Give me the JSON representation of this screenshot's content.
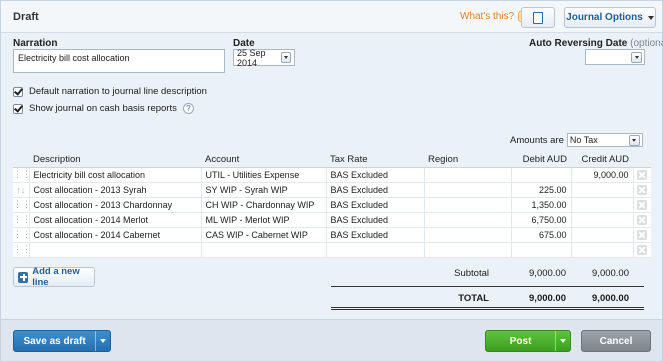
{
  "header": {
    "title": "Draft",
    "whats_this": "What's this?",
    "journal_options": "Journal Options"
  },
  "form": {
    "narration_label": "Narration",
    "narration_value": "Electricity bill cost allocation",
    "date_label": "Date",
    "date_value": "25 Sep 2014",
    "auto_reversing_label": "Auto Reversing Date",
    "auto_reversing_optional": "(optional)",
    "auto_reversing_value": "",
    "default_narration_label": "Default narration to journal line description",
    "default_narration_checked": true,
    "cash_basis_label": "Show journal on cash basis reports",
    "cash_basis_checked": true,
    "help_glyph": "?"
  },
  "amounts": {
    "label": "Amounts are",
    "value": "No Tax"
  },
  "table": {
    "columns": {
      "description": "Description",
      "account": "Account",
      "tax_rate": "Tax Rate",
      "region": "Region",
      "debit": "Debit AUD",
      "credit": "Credit AUD"
    },
    "rows": [
      {
        "handle": "⋮⋮",
        "description": "Electricity bill cost allocation",
        "account": "UTIL - Utilities Expense",
        "tax_rate": "BAS Excluded",
        "region": "",
        "debit": "",
        "credit": "9,000.00"
      },
      {
        "handle": "↑↓",
        "description": "Cost allocation - 2013 Syrah",
        "account": "SY WIP - Syrah WIP",
        "tax_rate": "BAS Excluded",
        "region": "",
        "debit": "225.00",
        "credit": ""
      },
      {
        "handle": "⋮⋮",
        "description": "Cost allocation - 2013 Chardonnay",
        "account": "CH WIP - Chardonnay WIP",
        "tax_rate": "BAS Excluded",
        "region": "",
        "debit": "1,350.00",
        "credit": ""
      },
      {
        "handle": "⋮⋮",
        "description": "Cost allocation - 2014 Merlot",
        "account": "ML WIP - Merlot WIP",
        "tax_rate": "BAS Excluded",
        "region": "",
        "debit": "6,750.00",
        "credit": ""
      },
      {
        "handle": "⋮⋮",
        "description": "Cost allocation - 2014 Cabernet",
        "account": "CAS WIP - Cabernet WIP",
        "tax_rate": "BAS Excluded",
        "region": "",
        "debit": "675.00",
        "credit": ""
      },
      {
        "handle": "⋮⋮",
        "description": "",
        "account": "",
        "tax_rate": "",
        "region": "",
        "debit": "",
        "credit": ""
      }
    ]
  },
  "add_line": "Add a new line",
  "totals": {
    "subtotal_label": "Subtotal",
    "subtotal_debit": "9,000.00",
    "subtotal_credit": "9,000.00",
    "total_label": "TOTAL",
    "total_debit": "9,000.00",
    "total_credit": "9,000.00"
  },
  "footer": {
    "save_draft": "Save as draft",
    "post": "Post",
    "cancel": "Cancel"
  },
  "colors": {
    "save_blue": "#2f7fc0",
    "post_green": "#4caf2c",
    "cancel_grey": "#8a9299",
    "link_orange": "#d9822b"
  }
}
